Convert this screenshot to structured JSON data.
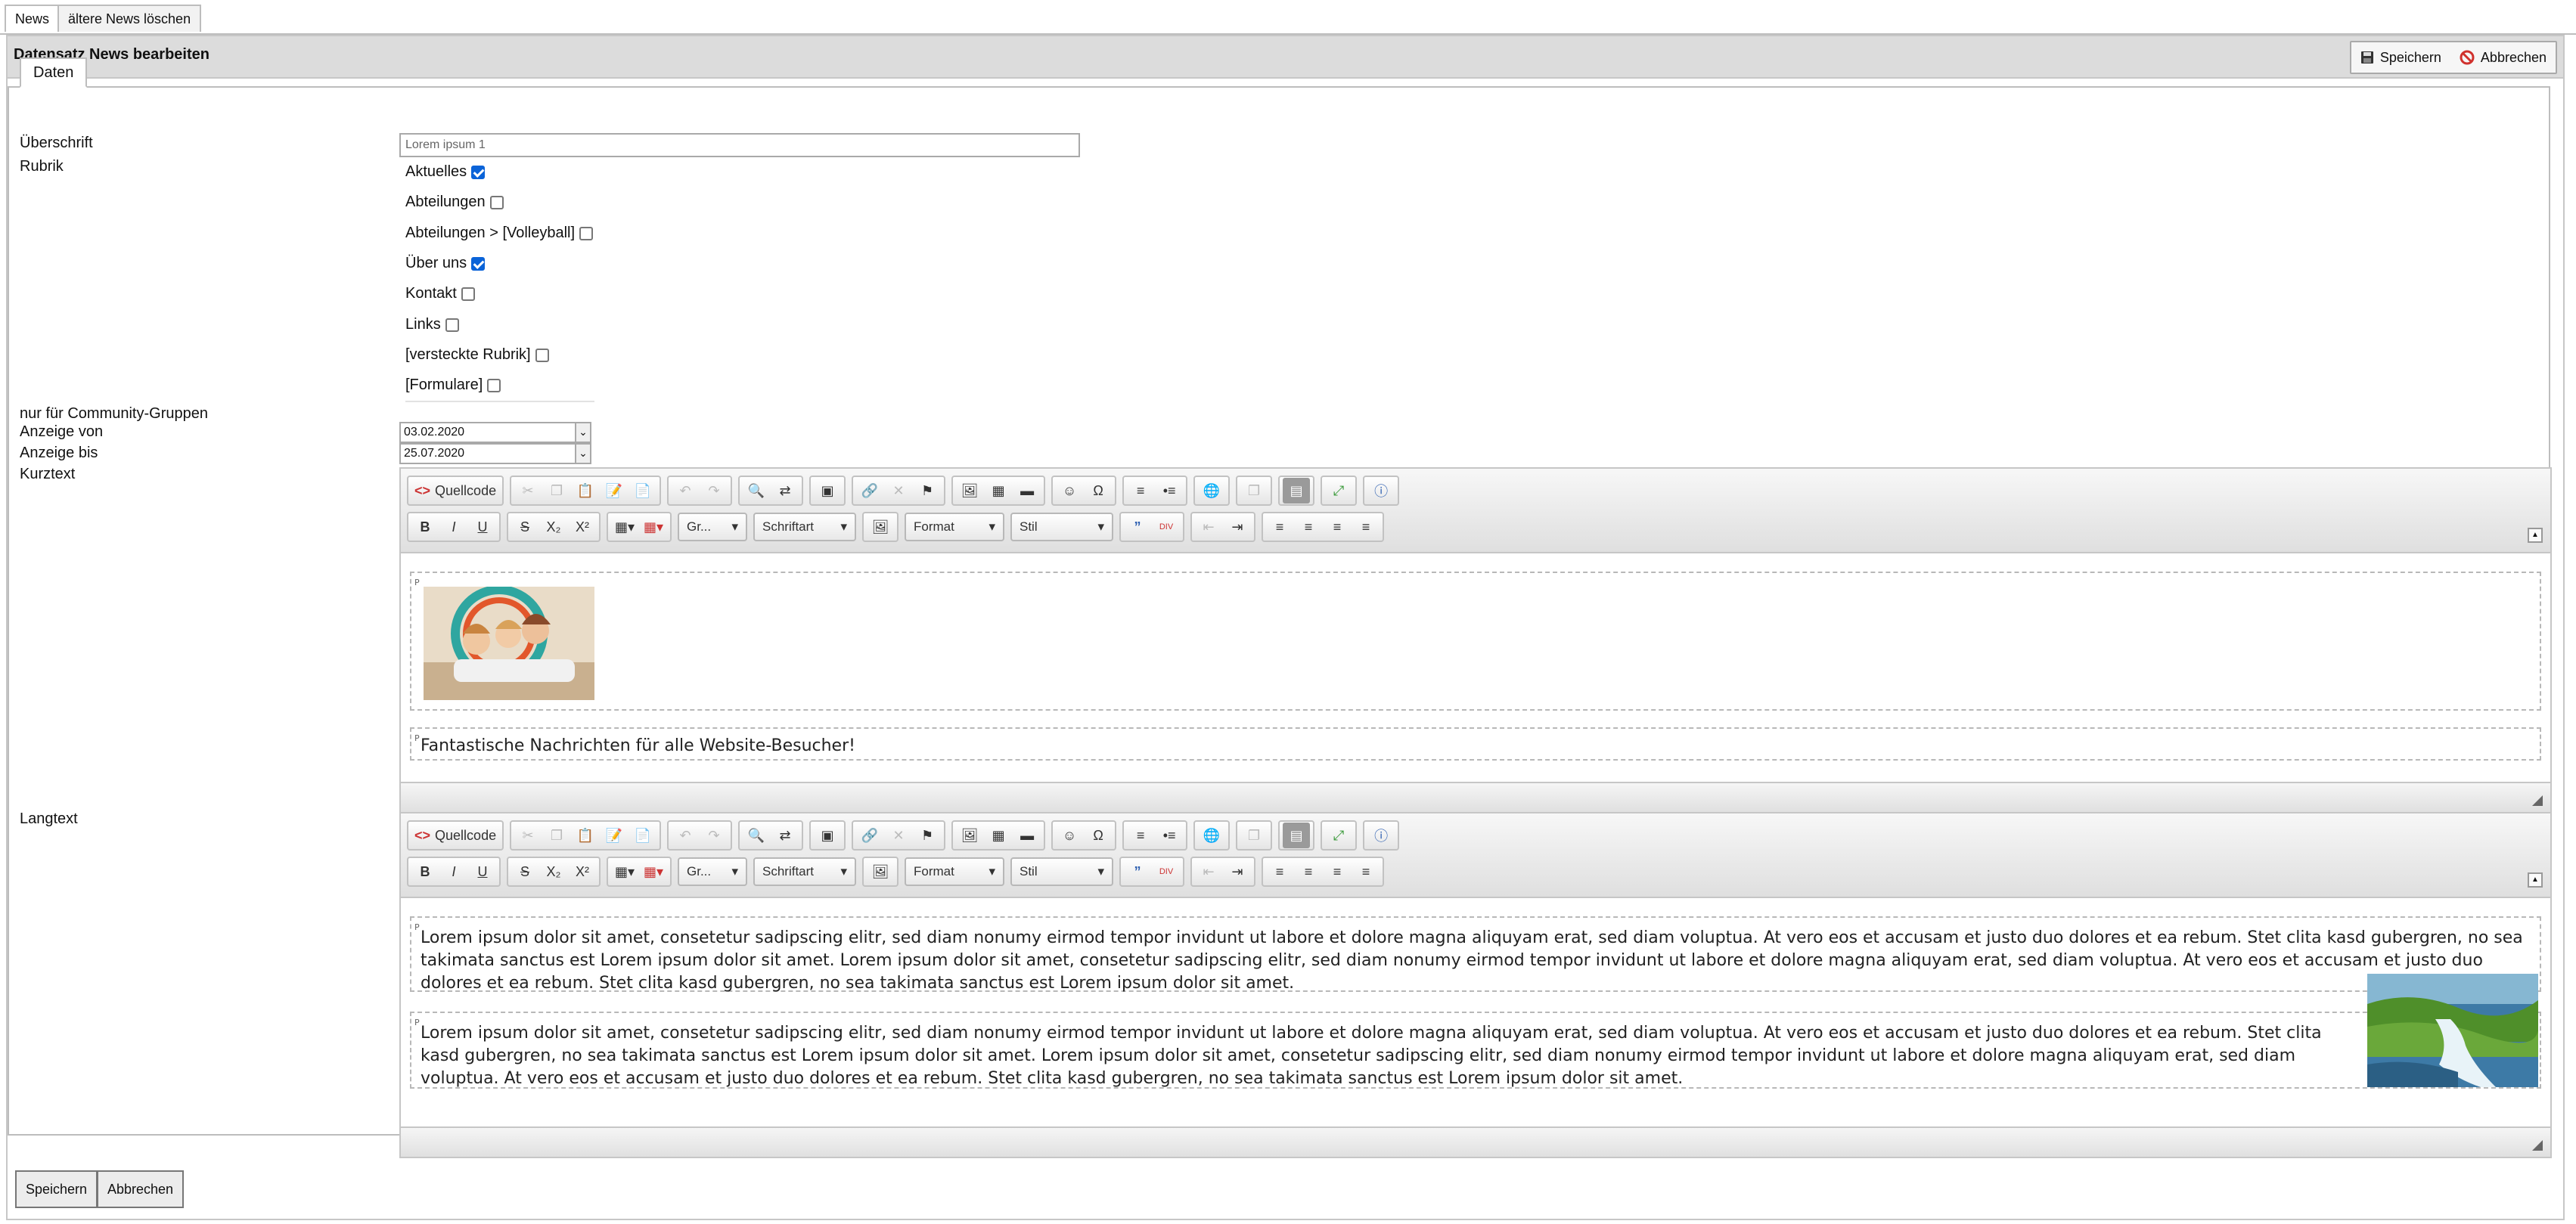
{
  "top_tabs": [
    "News",
    "ältere News löschen"
  ],
  "panel": {
    "title": "Datensatz News bearbeiten",
    "save_label": "Speichern",
    "cancel_label": "Abbrechen"
  },
  "form": {
    "tab_label": "Daten",
    "labels": {
      "ueberschrift": "Überschrift",
      "rubrik": "Rubrik",
      "community": "nur für Community-Gruppen",
      "anzeige_von": "Anzeige von",
      "anzeige_bis": "Anzeige bis",
      "kurztext": "Kurztext",
      "langtext": "Langtext"
    },
    "ueberschrift_value": "Lorem ipsum 1",
    "rubriken": [
      {
        "label": "Aktuelles",
        "checked": true
      },
      {
        "label": "Abteilungen",
        "checked": false
      },
      {
        "label": "Abteilungen > [Volleyball]",
        "checked": false
      },
      {
        "label": "Über uns",
        "checked": true
      },
      {
        "label": "Kontakt",
        "checked": false
      },
      {
        "label": "Links",
        "checked": false
      },
      {
        "label": "[versteckte Rubrik]",
        "checked": false
      },
      {
        "label": "[Formulare]",
        "checked": false
      }
    ],
    "anzeige_von": "03.02.2020",
    "anzeige_bis": "25.07.2020"
  },
  "editor": {
    "source_label": "Quellcode",
    "size_combo": "Gr...",
    "font_combo": "Schriftart",
    "format_combo": "Format",
    "style_combo": "Stil",
    "paragraph_tag": "P"
  },
  "kurztext": {
    "paragraph": "Fantastische Nachrichten für alle Website-Besucher!"
  },
  "langtext": {
    "paragraph1": "Lorem ipsum dolor sit amet, consetetur sadipscing elitr, sed diam nonumy eirmod tempor invidunt ut labore et dolore magna aliquyam erat, sed diam voluptua. At vero eos et accusam et justo duo dolores et ea rebum. Stet clita kasd gubergren, no sea takimata sanctus est Lorem ipsum dolor sit amet. Lorem ipsum dolor sit amet, consetetur sadipscing elitr, sed diam nonumy eirmod tempor invidunt ut labore et dolore magna aliquyam erat, sed diam voluptua. At vero eos et accusam et justo duo dolores et ea rebum. Stet clita kasd gubergren, no sea takimata sanctus est Lorem ipsum dolor sit amet.",
    "paragraph2": "Lorem ipsum dolor sit amet, consetetur sadipscing elitr, sed diam nonumy eirmod tempor invidunt ut labore et dolore magna aliquyam erat, sed diam voluptua. At vero eos et accusam et justo duo dolores et ea rebum. Stet clita kasd gubergren, no sea takimata sanctus est Lorem ipsum dolor sit amet. Lorem ipsum dolor sit amet, consetetur sadipscing elitr, sed diam nonumy eirmod tempor invidunt ut labore et dolore magna aliquyam erat, sed diam voluptua. At vero eos et accusam et justo duo dolores et ea rebum. Stet clita kasd gubergren, no sea takimata sanctus est Lorem ipsum dolor sit amet."
  },
  "footer": {
    "save_label": "Speichern",
    "cancel_label": "Abbrechen"
  },
  "colors": {
    "checkbox_checked": "#0a63d8",
    "header_bg": "#dcdcdc",
    "cancel_icon": "#d0312d"
  }
}
